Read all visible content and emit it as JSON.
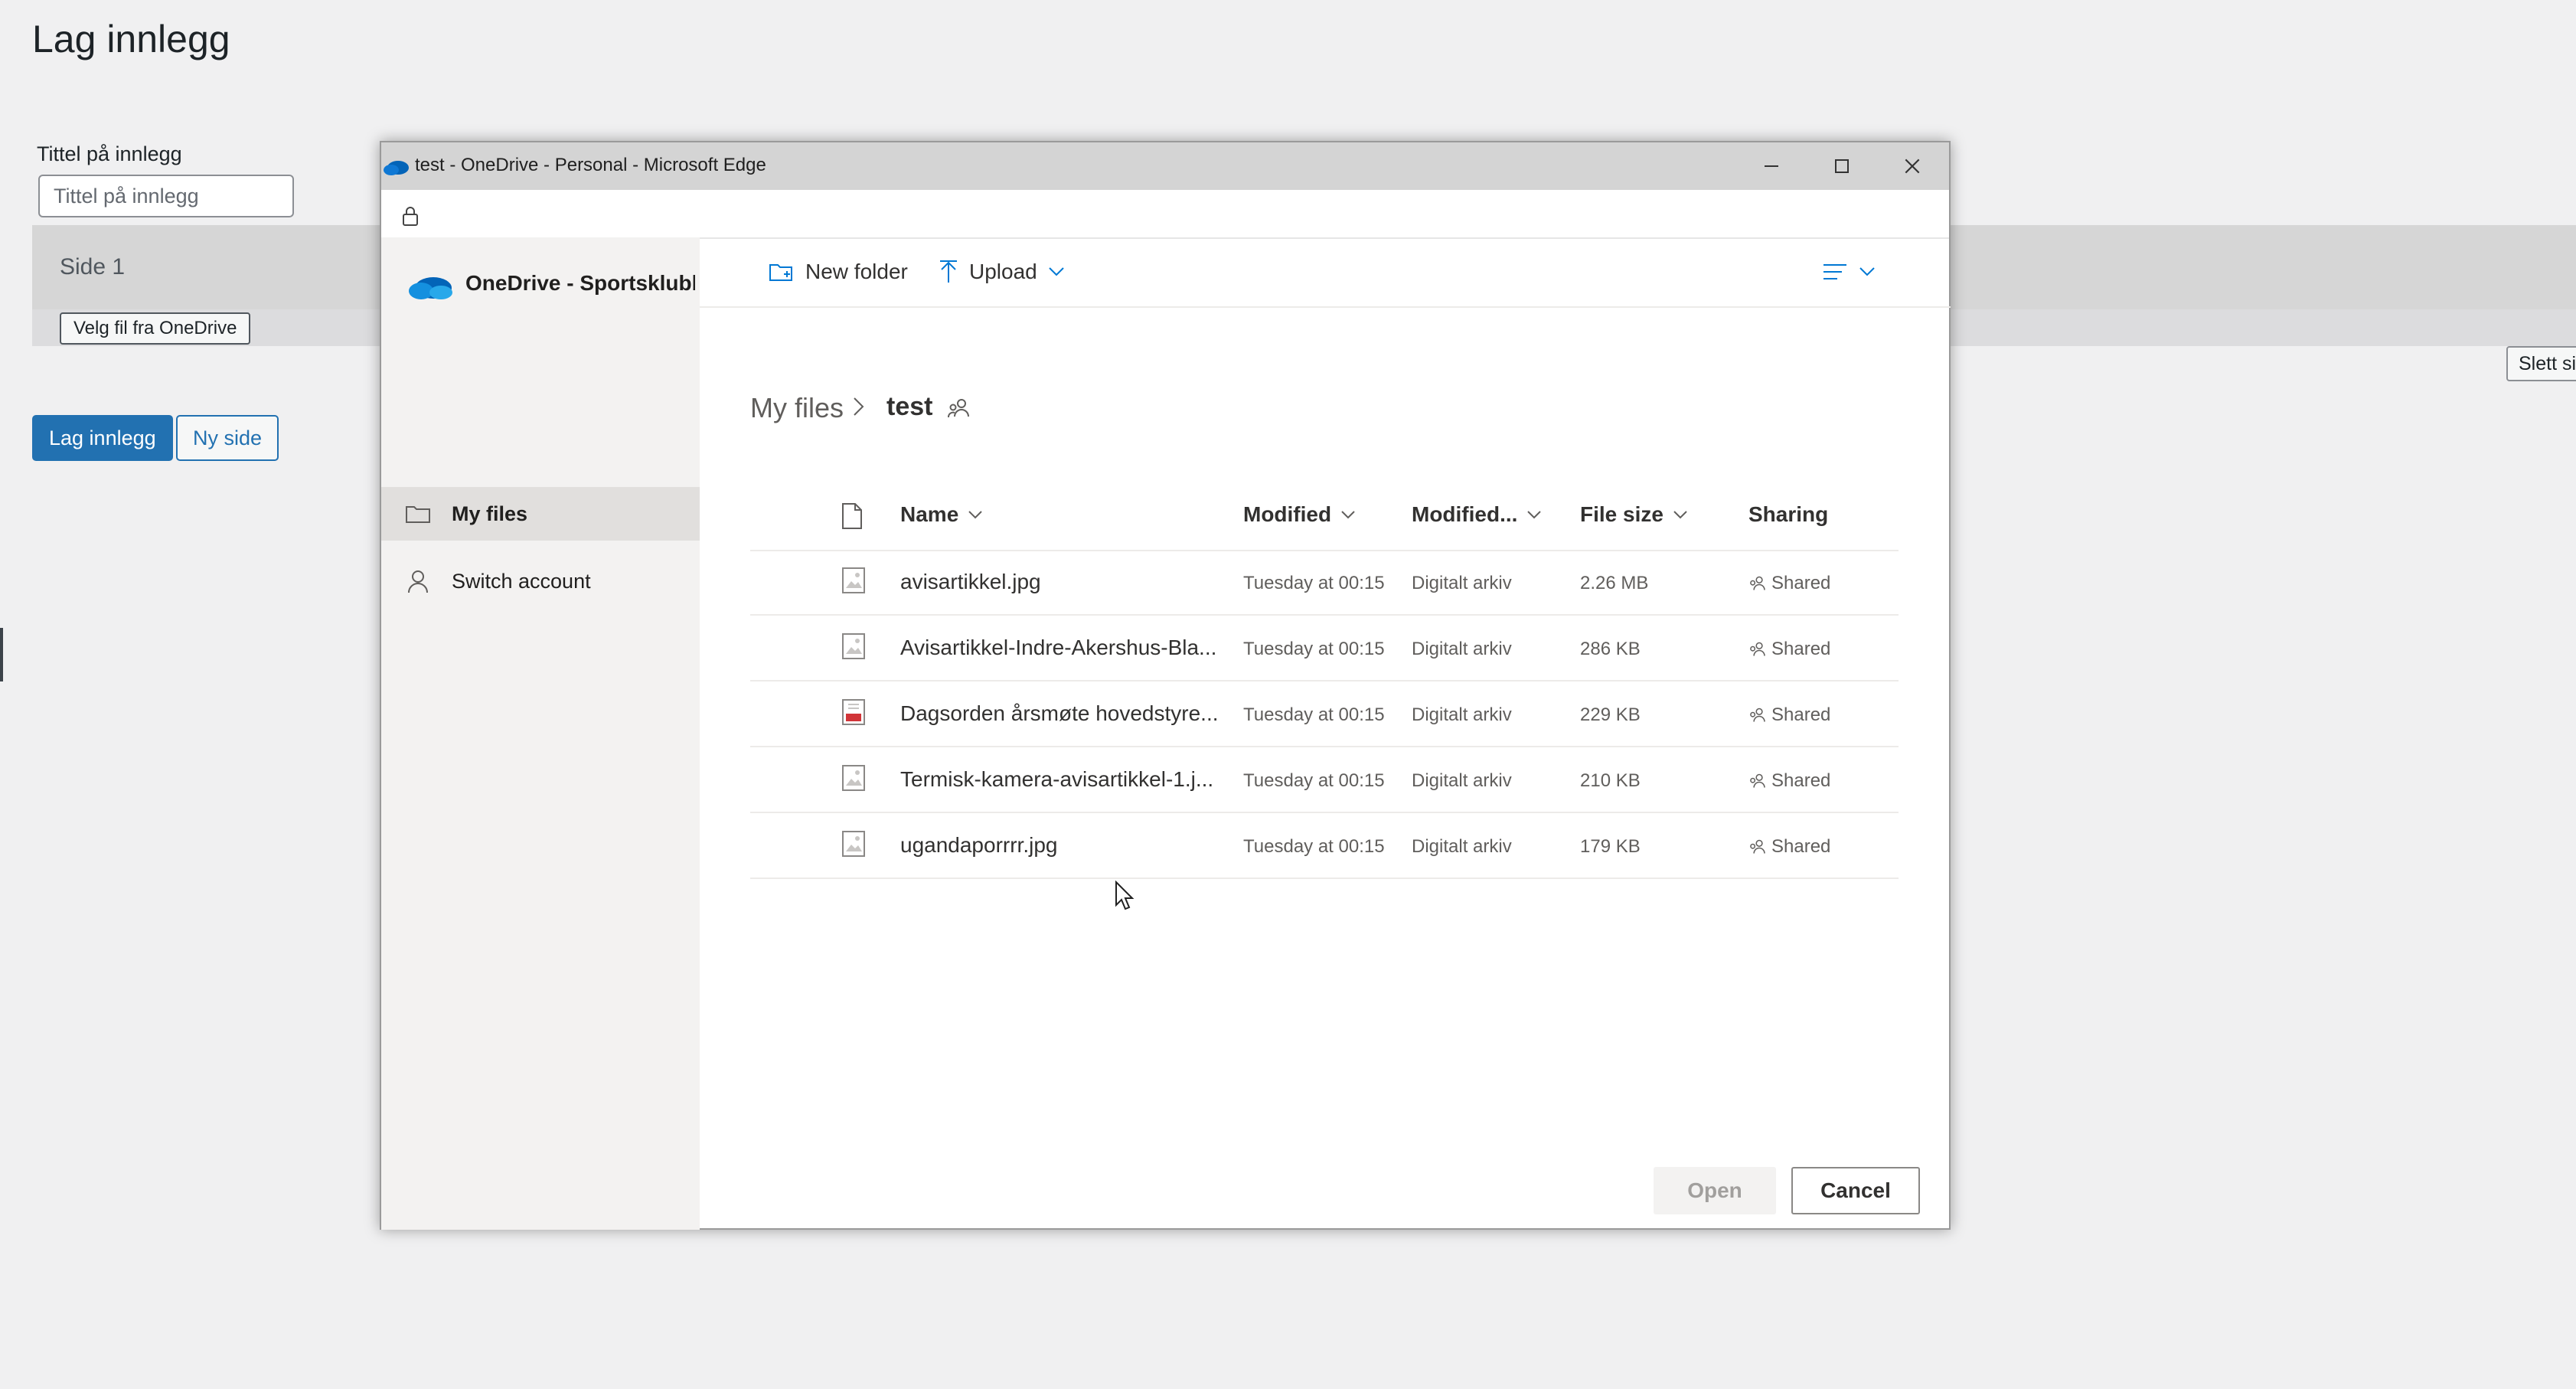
{
  "page": {
    "title": "Lag innlegg",
    "title_field_label": "Tittel på innlegg",
    "title_field_placeholder": "Tittel på innlegg",
    "section_label": "Side 1",
    "choose_file_button": "Velg fil fra OneDrive",
    "delete_button": "Slett side",
    "publish_button": "Lag innlegg",
    "new_page_button": "Ny side"
  },
  "window": {
    "title": "test - OneDrive - Personal - Microsoft Edge"
  },
  "picker": {
    "brand": "OneDrive - Sportsklubb",
    "nav": [
      {
        "label": "My files",
        "icon": "folder-icon",
        "selected": true
      },
      {
        "label": "Switch account",
        "icon": "person-icon",
        "selected": false
      }
    ],
    "commands": {
      "new_folder": "New folder",
      "upload": "Upload"
    },
    "breadcrumb": {
      "root": "My files",
      "current": "test"
    },
    "columns": {
      "name": "Name",
      "modified": "Modified",
      "modified_by": "Modified...",
      "file_size": "File size",
      "sharing": "Sharing"
    },
    "files": [
      {
        "name": "avisartikkel.jpg",
        "type": "image",
        "modified": "Tuesday at 00:15",
        "modified_by": "Digitalt arkiv",
        "size": "2.26 MB",
        "sharing": "Shared"
      },
      {
        "name": "Avisartikkel-Indre-Akershus-Bla...",
        "type": "image",
        "modified": "Tuesday at 00:15",
        "modified_by": "Digitalt arkiv",
        "size": "286 KB",
        "sharing": "Shared"
      },
      {
        "name": "Dagsorden årsmøte hovedstyre...",
        "type": "pdf",
        "modified": "Tuesday at 00:15",
        "modified_by": "Digitalt arkiv",
        "size": "229 KB",
        "sharing": "Shared"
      },
      {
        "name": "Termisk-kamera-avisartikkel-1.j...",
        "type": "image",
        "modified": "Tuesday at 00:15",
        "modified_by": "Digitalt arkiv",
        "size": "210 KB",
        "sharing": "Shared"
      },
      {
        "name": "ugandaporrrr.jpg",
        "type": "image",
        "modified": "Tuesday at 00:15",
        "modified_by": "Digitalt arkiv",
        "size": "179 KB",
        "sharing": "Shared"
      }
    ],
    "open_button": "Open",
    "cancel_button": "Cancel"
  },
  "colors": {
    "wp_primary": "#2271b1",
    "onedrive_blue": "#0364b8",
    "pdf_red": "#d13438"
  }
}
